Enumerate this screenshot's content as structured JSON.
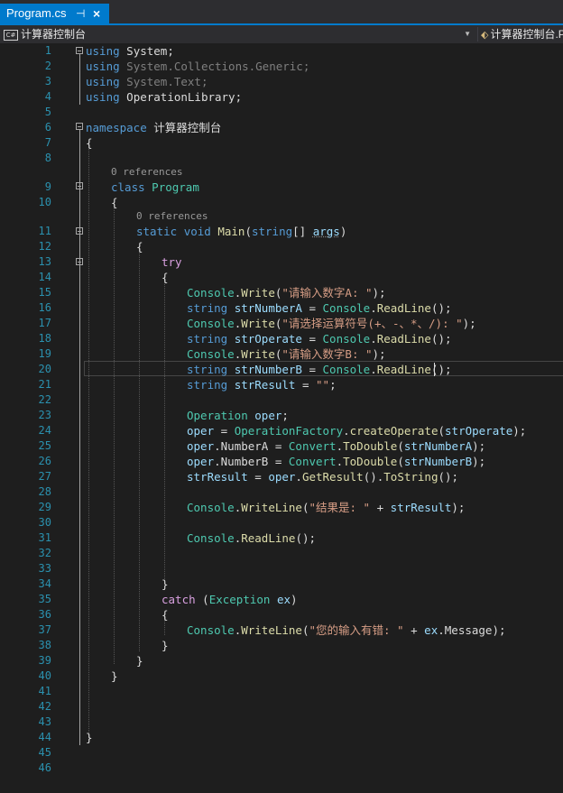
{
  "tab": {
    "title": "Program.cs",
    "pin_glyph": "⊣",
    "close_glyph": "×"
  },
  "navbar": {
    "left_label": "计算器控制台",
    "left_icon": "C#",
    "right_label": "计算器控制台.Program"
  },
  "colors": {
    "accent": "#007acc",
    "keyword": "#569cd6",
    "type": "#4ec9b0",
    "method": "#dcdcaa",
    "string": "#d69d85",
    "line_number": "#2b91af"
  },
  "editor": {
    "line_numbers": [
      "1",
      "2",
      "3",
      "4",
      "5",
      "6",
      "7",
      "8",
      "9",
      "10",
      "11",
      "12",
      "13",
      "14",
      "15",
      "16",
      "17",
      "18",
      "19",
      "20",
      "21",
      "22",
      "23",
      "24",
      "25",
      "26",
      "27",
      "28",
      "29",
      "30",
      "31",
      "32",
      "33",
      "34",
      "35",
      "36",
      "37",
      "38",
      "39",
      "40",
      "41",
      "42",
      "43",
      "44",
      "45",
      "46"
    ],
    "references": [
      "0 references",
      "0 references"
    ],
    "code": {
      "l1": [
        "using",
        " System;"
      ],
      "l2": [
        "using",
        " System.Collections.Generic;"
      ],
      "l3": [
        "using",
        " System.Text;"
      ],
      "l4": [
        "using",
        " OperationLibrary;"
      ],
      "l6": [
        "namespace",
        " 计算器控制台"
      ],
      "l7": "{",
      "l9": [
        "class",
        " ",
        "Program"
      ],
      "l10": "{",
      "l11": [
        "static",
        " ",
        "void",
        " ",
        "Main",
        "(",
        "string",
        "[] ",
        "args",
        ")"
      ],
      "l12": "{",
      "l13": "try",
      "l14": "{",
      "l15": [
        "Console",
        ".",
        "Write",
        "(",
        "\"请输入数字A: \"",
        ");"
      ],
      "l16": [
        "string",
        " ",
        "strNumberA",
        " = ",
        "Console",
        ".",
        "ReadLine",
        "();"
      ],
      "l17": [
        "Console",
        ".",
        "Write",
        "(",
        "\"请选择运算符号(+、-、*、/): \"",
        ");"
      ],
      "l18": [
        "string",
        " ",
        "strOperate",
        " = ",
        "Console",
        ".",
        "ReadLine",
        "();"
      ],
      "l19": [
        "Console",
        ".",
        "Write",
        "(",
        "\"请输入数字B: \"",
        ");"
      ],
      "l20": [
        "string",
        " ",
        "strNumberB",
        " = ",
        "Console",
        ".",
        "ReadLine",
        "();"
      ],
      "l21": [
        "string",
        " ",
        "strResult",
        " = ",
        "\"\"",
        ";"
      ],
      "l23": [
        "Operation",
        " ",
        "oper",
        ";"
      ],
      "l24": [
        "oper",
        " = ",
        "OperationFactory",
        ".",
        "createOperate",
        "(",
        "strOperate",
        ");"
      ],
      "l25": [
        "oper",
        ".",
        "NumberA",
        " = ",
        "Convert",
        ".",
        "ToDouble",
        "(",
        "strNumberA",
        ");"
      ],
      "l26": [
        "oper",
        ".",
        "NumberB",
        " = ",
        "Convert",
        ".",
        "ToDouble",
        "(",
        "strNumberB",
        ");"
      ],
      "l27": [
        "strResult",
        " = ",
        "oper",
        ".",
        "GetResult",
        "().",
        "ToString",
        "();"
      ],
      "l29": [
        "Console",
        ".",
        "WriteLine",
        "(",
        "\"结果是: \"",
        " + ",
        "strResult",
        ");"
      ],
      "l31": [
        "Console",
        ".",
        "ReadLine",
        "();"
      ],
      "l34": "}",
      "l35": [
        "catch",
        " (",
        "Exception",
        " ",
        "ex",
        ")"
      ],
      "l36": "{",
      "l37": [
        "Console",
        ".",
        "WriteLine",
        "(",
        "\"您的输入有错: \"",
        " + ",
        "ex",
        ".",
        "Message",
        ");"
      ],
      "l38": "}",
      "l39": "}",
      "l40": "}",
      "l44": "}"
    }
  }
}
